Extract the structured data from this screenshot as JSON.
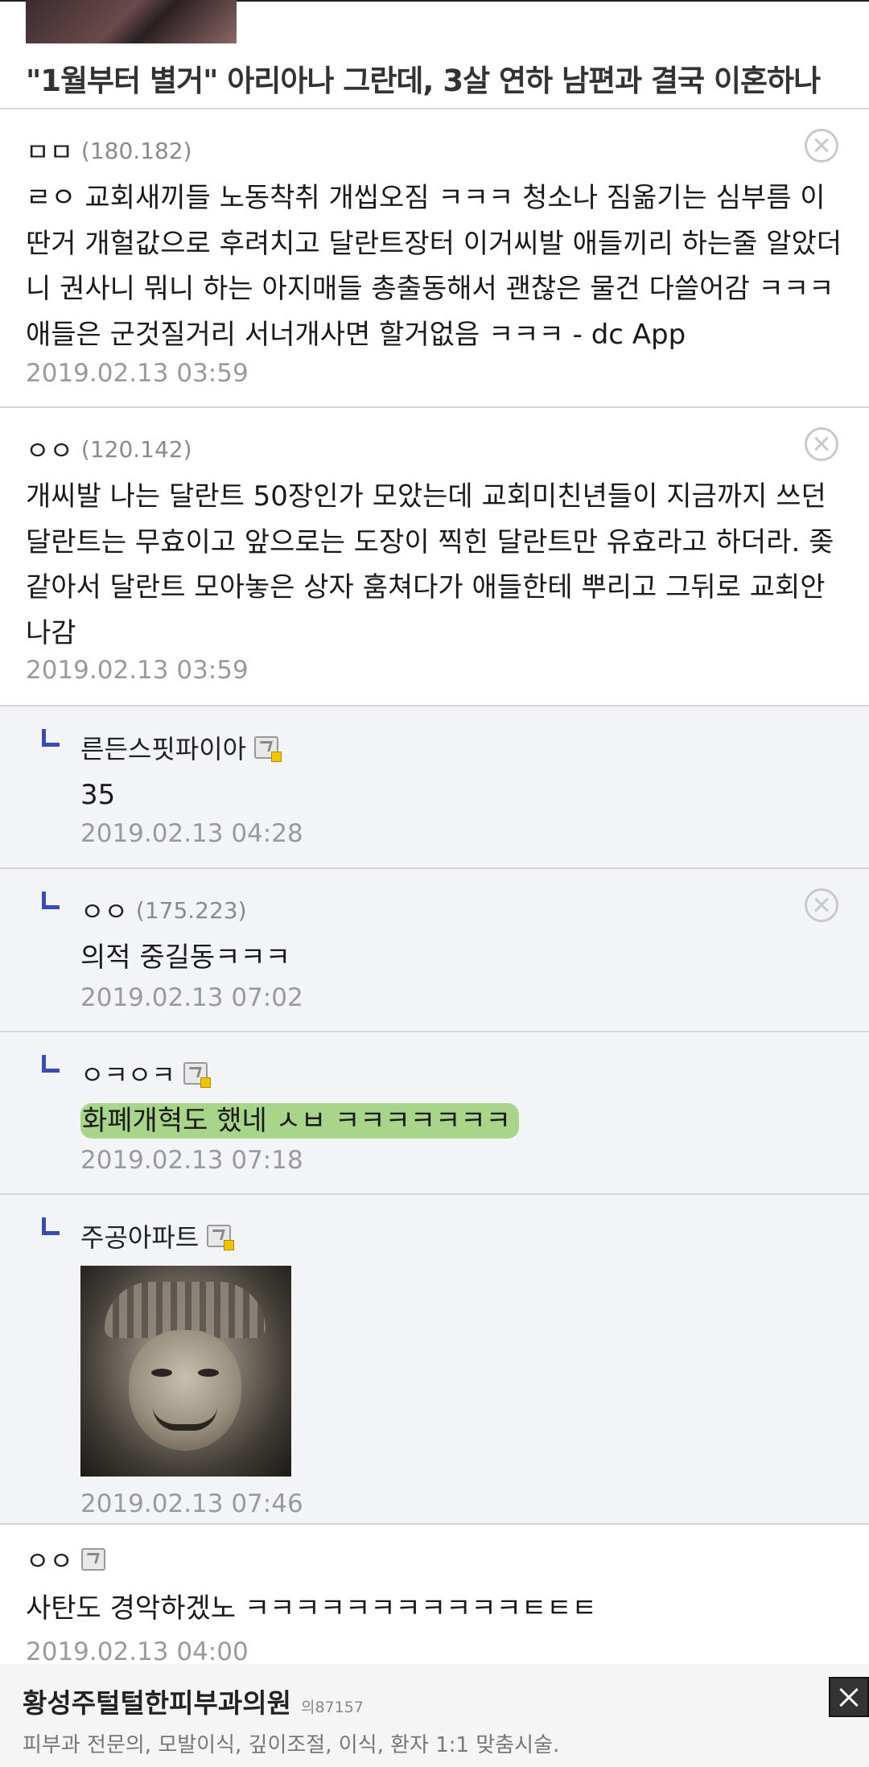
{
  "article": {
    "title": "\"1월부터 별거\" 아리아나 그란데, 3살 연하 남편과 결국 이혼하나"
  },
  "comments": [
    {
      "author": "ㅁㅁ",
      "ip": "(180.182)",
      "text": "ㄹㅇ 교회새끼들 노동착취 개씹오짐 ㅋㅋㅋ 청소나 짐옮기는 심부름 이딴거 개헐값으로 후려치고 달란트장터 이거씨발 애들끼리 하는줄 알았더니 권사니 뭐니 하는 아지매들 총출동해서 괜찮은 물건 다쓸어감 ㅋㅋㅋ 애들은 군것질거리 서너개사면 할거없음 ㅋㅋㅋ - dc App",
      "date": "2019.02.13 03:59"
    },
    {
      "author": "ㅇㅇ",
      "ip": "(120.142)",
      "text": "개씨발 나는 달란트 50장인가 모았는데 교회미친년들이 지금까지 쓰던 달란트는 무효이고 앞으로는 도장이 찍힌 달란트만 유효라고 하더라. 좆같아서 달란트 모아놓은 상자 훔쳐다가 애들한테 뿌리고 그뒤로 교회안나감",
      "date": "2019.02.13 03:59"
    }
  ],
  "replies": [
    {
      "author": "른든스핏파이아",
      "text": "35",
      "date": "2019.02.13 04:28"
    },
    {
      "author": "ㅇㅇ",
      "ip": "(175.223)",
      "text": "의적 중길동ㅋㅋㅋ",
      "date": "2019.02.13 07:02"
    },
    {
      "author": "ㅇㅋㅇㅋ",
      "text": "화폐개혁도 했네 ㅅㅂ ㅋㅋㅋㅋㅋㅋㅋ",
      "date": "2019.02.13 07:18"
    },
    {
      "author": "주공아파트",
      "date": "2019.02.13 07:46"
    }
  ],
  "last_comment": {
    "author": "ㅇㅇ",
    "text": "사탄도 경악하겠노 ㅋㅋㅋㅋㅋㅋㅋㅋㅋㅋㅋㅌㅌㅌ",
    "date": "2019.02.13 04:00"
  },
  "ad": {
    "title": "황성주털털한피부과의원",
    "small": "의87157",
    "desc": "피부과 전문의, 모발이식, 깊이조절, 이식, 환자 1:1 맞춤시술."
  },
  "colors": {
    "reply_bg": "#f3f4f8",
    "reply_arrow": "#3a4cb0",
    "highlight": "#a8d58a"
  }
}
